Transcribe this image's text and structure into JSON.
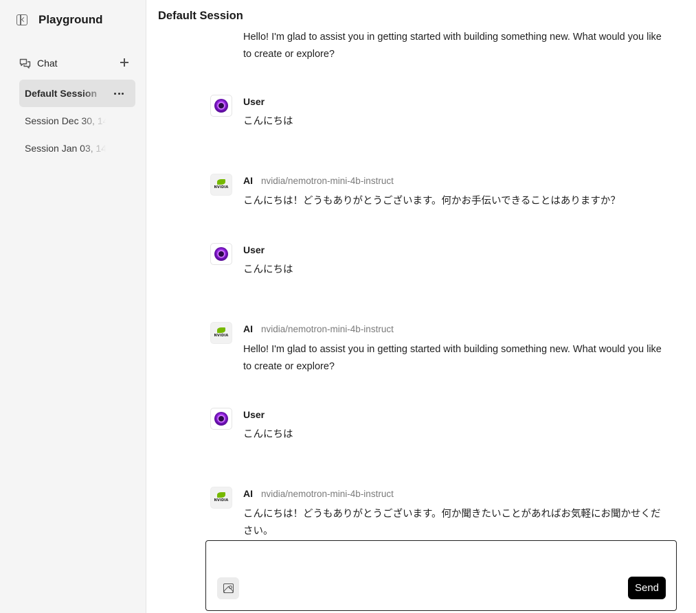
{
  "sidebar": {
    "title": "Playground",
    "chat_label": "Chat",
    "sessions": [
      {
        "label": "Default Session",
        "active": true
      },
      {
        "label": "Session Dec 30, 14"
      },
      {
        "label": "Session Jan 03, 14"
      }
    ]
  },
  "main": {
    "title": "Default Session",
    "messages": [
      {
        "role": "ai",
        "sender": "",
        "model": "",
        "text": "Hello! I'm glad to assist you in getting started with building something new. What would you like to create or explore?"
      },
      {
        "role": "user",
        "sender": "User",
        "text": "こんにちは"
      },
      {
        "role": "ai",
        "sender": "AI",
        "model": "nvidia/nemotron-mini-4b-instruct",
        "text": "こんにちは！どうもありがとうございます。何かお手伝いできることはありますか？"
      },
      {
        "role": "user",
        "sender": "User",
        "text": "こんにちは"
      },
      {
        "role": "ai",
        "sender": "AI",
        "model": "nvidia/nemotron-mini-4b-instruct",
        "text": "Hello! I'm glad to assist you in getting started with building something new. What would you like to create or explore?"
      },
      {
        "role": "user",
        "sender": "User",
        "text": "こんにちは"
      },
      {
        "role": "ai",
        "sender": "AI",
        "model": "nvidia/nemotron-mini-4b-instruct",
        "text": "こんにちは！どうもありがとうございます。何か聞きたいことがあればお気軽にお聞かせください。"
      }
    ]
  },
  "composer": {
    "value": "",
    "send_label": "Send",
    "image_icon": "image-icon"
  }
}
